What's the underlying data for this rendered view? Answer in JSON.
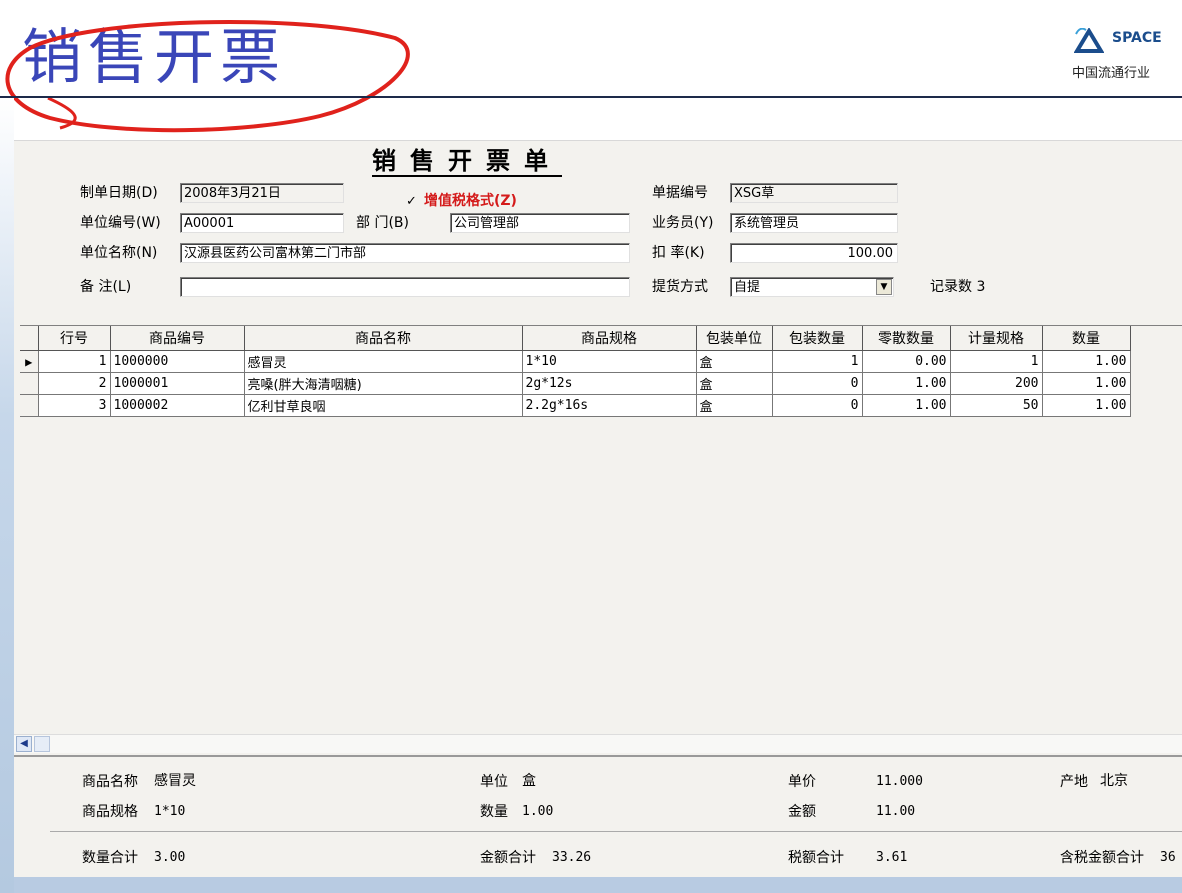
{
  "slide": {
    "title": "销售开票",
    "logo_brand": "SPACE",
    "logo_sub": "中国流通行业"
  },
  "form": {
    "title": "销售开票单",
    "fields": {
      "date": {
        "label": "制单日期(D)",
        "value": "2008年3月21日"
      },
      "vat": {
        "label": "增值税格式(Z)",
        "checked": true
      },
      "doc_no": {
        "label": "单据编号",
        "value": "XSG草"
      },
      "unit_code": {
        "label": "单位编号(W)",
        "value": "A00001"
      },
      "dept": {
        "label": "部  门(B)",
        "value": "公司管理部"
      },
      "salesman": {
        "label": "业务员(Y)",
        "value": "系统管理员"
      },
      "unit_name": {
        "label": "单位名称(N)",
        "value": "汉源县医药公司富林第二门市部"
      },
      "discount": {
        "label": "扣  率(K)",
        "value": "100.00"
      },
      "remark": {
        "label": "备    注(L)",
        "value": ""
      },
      "delivery": {
        "label": "提货方式",
        "value": "自提"
      },
      "record_count": {
        "label": "记录数",
        "value": "3"
      }
    }
  },
  "grid": {
    "columns": [
      "行号",
      "商品编号",
      "商品名称",
      "商品规格",
      "包装单位",
      "包装数量",
      "零散数量",
      "计量规格",
      "数量"
    ],
    "rows": [
      [
        "1",
        "1000000",
        "感冒灵",
        "1*10",
        "盒",
        "1",
        "0.00",
        "1",
        "1.00"
      ],
      [
        "2",
        "1000001",
        "亮嗓(胖大海清咽糖)",
        "2g*12s",
        "盒",
        "0",
        "1.00",
        "200",
        "1.00"
      ],
      [
        "3",
        "1000002",
        "亿利甘草良咽",
        "2.2g*16s",
        "盒",
        "0",
        "1.00",
        "50",
        "1.00"
      ]
    ]
  },
  "footer": {
    "name_label": "商品名称",
    "name": "感冒灵",
    "unit_label": "单位",
    "unit": "盒",
    "price_label": "单价",
    "price": "11.000",
    "origin_label": "产地",
    "origin": "北京",
    "spec_label": "商品规格",
    "spec": "1*10",
    "qty_label": "数量",
    "qty": "1.00",
    "amount_label": "金额",
    "amount": "11.00",
    "qty_total_label": "数量合计",
    "qty_total": "3.00",
    "amount_total_label": "金额合计",
    "amount_total": "33.26",
    "tax_total_label": "税额合计",
    "tax_total": "3.61",
    "tax_incl_label": "含税金额合计",
    "tax_incl_total": "36"
  },
  "colors": {
    "slide_title": "#3a46b8",
    "annotation": "#e0221c",
    "vat_label": "#d41b1b"
  },
  "icons": [
    "row-pointer-icon",
    "combo-arrow-icon",
    "scroll-left-icon",
    "checkbox-icon"
  ]
}
